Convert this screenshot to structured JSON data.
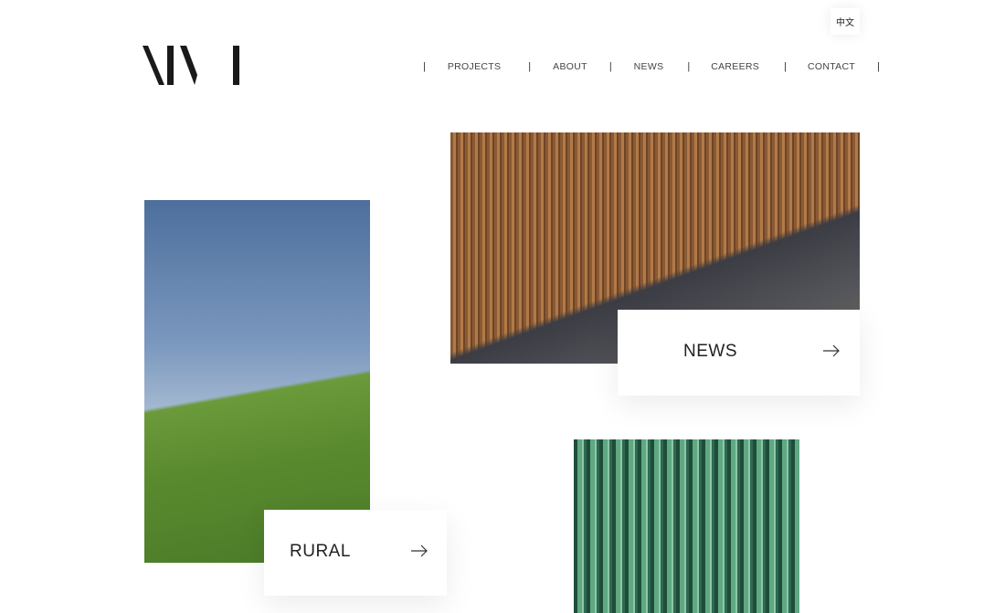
{
  "header": {
    "logo_text": "AIM",
    "language_toggle": "中文",
    "nav": [
      {
        "label": "PROJECTS"
      },
      {
        "label": "ABOUT"
      },
      {
        "label": "NEWS"
      },
      {
        "label": "CAREERS"
      },
      {
        "label": "CONTACT"
      }
    ]
  },
  "tiles": {
    "news": {
      "label": "NEWS",
      "icon": "arrow-right-icon"
    },
    "rural": {
      "label": "RURAL",
      "icon": "arrow-right-icon"
    }
  }
}
